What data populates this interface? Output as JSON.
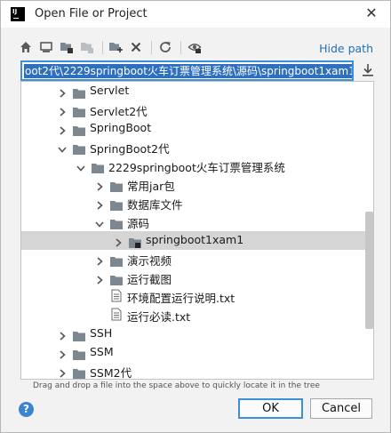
{
  "window": {
    "title": "Open File or Project"
  },
  "toolbar": {
    "icons": [
      "home-icon",
      "desktop-icon",
      "project-icon",
      "module-icon",
      "new-folder-icon",
      "delete-icon",
      "refresh-icon",
      "show-hidden-icon"
    ],
    "hide_path": "Hide path"
  },
  "path": {
    "value": "oot2代\\2229springboot火车订票管理系统\\源码\\springboot1xam1"
  },
  "tree": {
    "rows": [
      {
        "label": "Servlet",
        "level": 0,
        "expanded": false,
        "kind": "folder"
      },
      {
        "label": "Servlet2代",
        "level": 0,
        "expanded": false,
        "kind": "folder"
      },
      {
        "label": "SpringBoot",
        "level": 0,
        "expanded": false,
        "kind": "folder"
      },
      {
        "label": "SpringBoot2代",
        "level": 0,
        "expanded": true,
        "kind": "folder"
      },
      {
        "label": "2229springboot火车订票管理系统",
        "level": 1,
        "expanded": true,
        "kind": "folder"
      },
      {
        "label": "常用jar包",
        "level": 2,
        "expanded": false,
        "kind": "folder"
      },
      {
        "label": "数据库文件",
        "level": 2,
        "expanded": false,
        "kind": "folder"
      },
      {
        "label": "源码",
        "level": 2,
        "expanded": true,
        "kind": "folder"
      },
      {
        "label": "springboot1xam1",
        "level": 3,
        "expanded": false,
        "kind": "module",
        "selected": true
      },
      {
        "label": "演示视频",
        "level": 2,
        "expanded": false,
        "kind": "folder"
      },
      {
        "label": "运行截图",
        "level": 2,
        "expanded": false,
        "kind": "folder"
      },
      {
        "label": "环境配置运行说明.txt",
        "level": 2,
        "kind": "file"
      },
      {
        "label": "运行必读.txt",
        "level": 2,
        "kind": "file"
      },
      {
        "label": "SSH",
        "level": 0,
        "expanded": false,
        "kind": "folder"
      },
      {
        "label": "SSM",
        "level": 0,
        "expanded": false,
        "kind": "folder"
      },
      {
        "label": "SSM2代",
        "level": 0,
        "expanded": false,
        "kind": "folder"
      }
    ]
  },
  "hint": "Drag and drop a file into the space above to quickly locate it in the tree",
  "buttons": {
    "ok": "OK",
    "cancel": "Cancel",
    "help": "?"
  },
  "colors": {
    "accent": "#3d8fd8",
    "selection_bg": "#d5d5d5",
    "folder": "#7c8790",
    "link": "#2470b3"
  }
}
